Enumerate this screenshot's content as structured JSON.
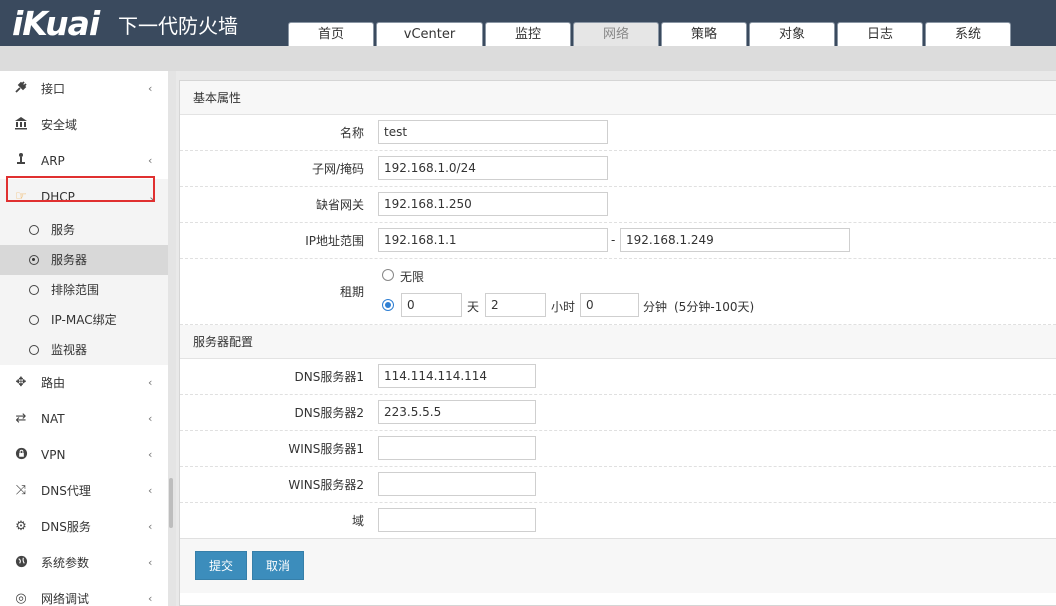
{
  "brand": {
    "logo": "iKuai",
    "product": "下一代防火墙"
  },
  "tabs": [
    "首页",
    "vCenter",
    "监控",
    "网络",
    "策略",
    "对象",
    "日志",
    "系统"
  ],
  "active_tab": "网络",
  "sidebar": {
    "items": [
      {
        "label": "接口",
        "icon": "plug-icon"
      },
      {
        "label": "安全域",
        "icon": "bank-icon"
      },
      {
        "label": "ARP",
        "icon": "arp-icon"
      },
      {
        "label": "DHCP",
        "icon": "hand-point-icon",
        "open": true
      },
      {
        "label": "路由",
        "icon": "move-arrows-icon"
      },
      {
        "label": "NAT",
        "icon": "exchange-icon"
      },
      {
        "label": "VPN",
        "icon": "lock-icon"
      },
      {
        "label": "DNS代理",
        "icon": "shuffle-icon"
      },
      {
        "label": "DNS服务",
        "icon": "cogs-icon"
      },
      {
        "label": "系统参数",
        "icon": "globe-icon"
      },
      {
        "label": "网络调试",
        "icon": "target-icon"
      }
    ],
    "dhcp_subitems": [
      "服务",
      "服务器",
      "排除范围",
      "IP-MAC绑定",
      "监视器"
    ],
    "active_subitem": "服务器"
  },
  "basic": {
    "title": "基本属性",
    "name_label": "名称",
    "name_value": "test",
    "subnet_label": "子网/掩码",
    "subnet_value": "192.168.1.0/24",
    "gateway_label": "缺省网关",
    "gateway_value": "192.168.1.250",
    "range_label": "IP地址范围",
    "range_start": "192.168.1.1",
    "range_sep": "-",
    "range_end": "192.168.1.249",
    "lease_label": "租期",
    "unlimited_label": "无限",
    "lease_days": "0",
    "days_unit": "天",
    "lease_hours": "2",
    "hours_unit": "小时",
    "lease_minutes": "0",
    "minutes_unit": "分钟",
    "lease_hint": "(5分钟-100天)"
  },
  "server": {
    "title": "服务器配置",
    "dns1_label": "DNS服务器1",
    "dns1_value": "114.114.114.114",
    "dns2_label": "DNS服务器2",
    "dns2_value": "223.5.5.5",
    "wins1_label": "WINS服务器1",
    "wins1_value": "",
    "wins2_label": "WINS服务器2",
    "wins2_value": "",
    "domain_label": "域",
    "domain_value": ""
  },
  "buttons": {
    "submit": "提交",
    "cancel": "取消"
  }
}
